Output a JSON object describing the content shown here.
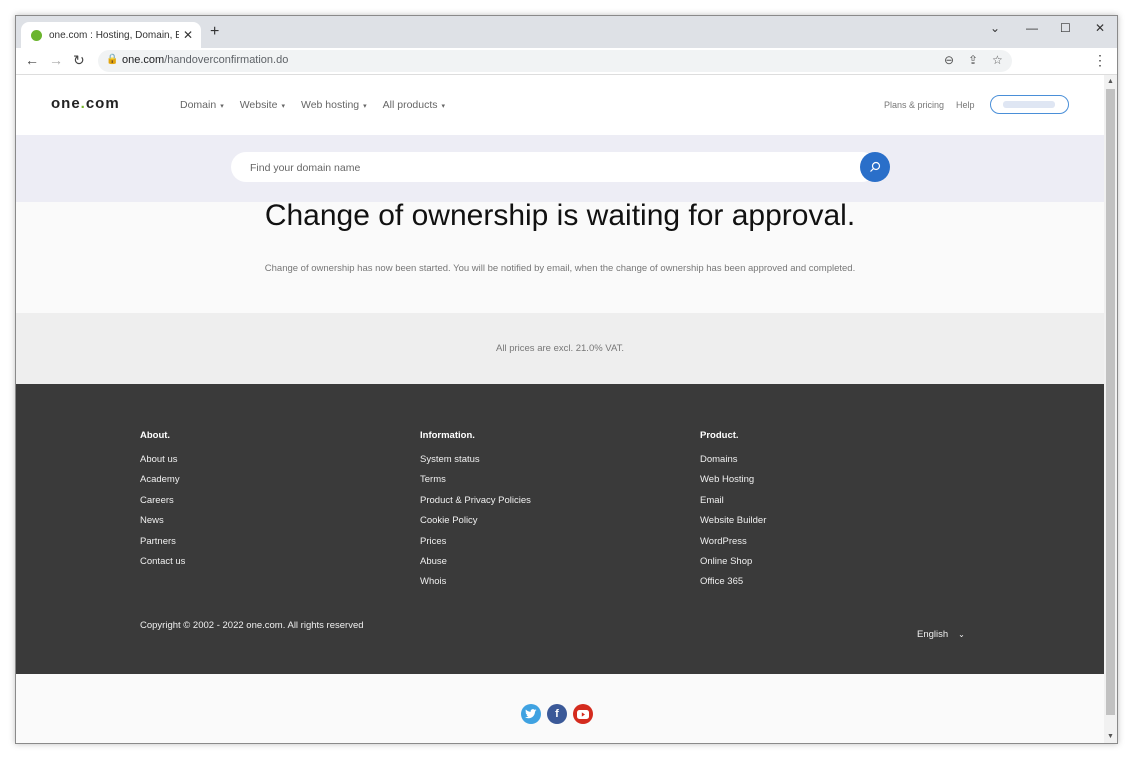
{
  "browser": {
    "tab_title": "one.com : Hosting, Domain, Email",
    "tab_favicon_color": "#6ab42d",
    "url_host": "one.com",
    "url_path": "/handoverconfirmation.do"
  },
  "header": {
    "logo_prefix": "one",
    "logo_dot": ".",
    "logo_suffix": "com",
    "logo_dot_color": "#76b82a",
    "nav": [
      {
        "label": "Domain"
      },
      {
        "label": "Website"
      },
      {
        "label": "Web hosting"
      },
      {
        "label": "All products"
      }
    ],
    "plans_label": "Plans & pricing",
    "help_label": "Help"
  },
  "search": {
    "placeholder": "Find your domain name",
    "value": "",
    "button_color": "#2a6fc9"
  },
  "main": {
    "title": "Change of ownership is waiting for approval.",
    "message": "Change of ownership has now been started. You will be notified by email, when the change of ownership has been approved and completed."
  },
  "vat_note": "All prices are excl. 21.0% VAT.",
  "footer": {
    "columns": [
      {
        "heading": "About.",
        "links": [
          "About us",
          "Academy",
          "Careers",
          "News",
          "Partners",
          "Contact us"
        ]
      },
      {
        "heading": "Information.",
        "links": [
          "System status",
          "Terms",
          "Product & Privacy Policies",
          "Cookie Policy",
          "Prices",
          "Abuse",
          "Whois"
        ]
      },
      {
        "heading": "Product.",
        "links": [
          "Domains",
          "Web Hosting",
          "Email",
          "Website Builder",
          "WordPress",
          "Online Shop",
          "Office 365"
        ]
      }
    ],
    "copyright": "Copyright © 2002 - 2022 one.com. All rights reserved",
    "language": "English"
  },
  "social": [
    {
      "name": "twitter",
      "color": "#3fa2e1"
    },
    {
      "name": "facebook",
      "color": "#3b5998"
    },
    {
      "name": "youtube",
      "color": "#d42b1e"
    }
  ]
}
